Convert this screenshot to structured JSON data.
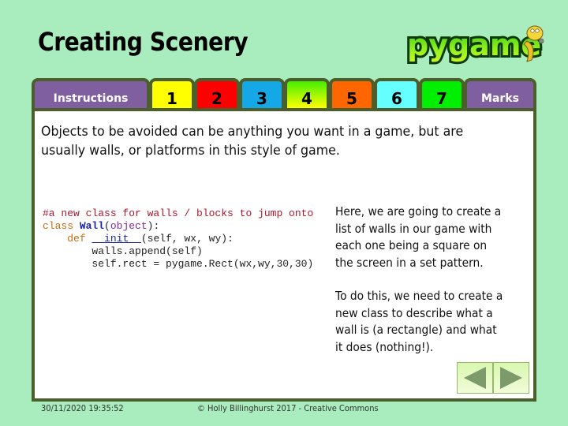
{
  "header": {
    "title": "Creating Scenery",
    "logo_text": "pygame"
  },
  "tabs": [
    {
      "label": "Instructions",
      "color": "#7f5fa0"
    },
    {
      "label": "1",
      "color": "#ffff00"
    },
    {
      "label": "2",
      "color": "#ff0000"
    },
    {
      "label": "3",
      "color": "#14a8e6"
    },
    {
      "label": "4",
      "color": "linear-gradient(#44ee00, #ffff00)"
    },
    {
      "label": "5",
      "color": "#ff6600"
    },
    {
      "label": "6",
      "color": "#66ffff"
    },
    {
      "label": "7",
      "color": "#00ee00"
    },
    {
      "label": "Marks",
      "color": "#7f5fa0"
    }
  ],
  "content": {
    "intro": "Objects to be avoided can be anything you want in a game, but are usually walls, or platforms in this style of game.",
    "code": {
      "line1_comment": "#a new class for walls / blocks to jump onto",
      "line2_kw": "class ",
      "line2_name": "Wall",
      "line2_paren_open": "(",
      "line2_base": "object",
      "line2_rest": "):",
      "line3_indent": "    ",
      "line3_kw": "def ",
      "line3_fn": "__init__",
      "line3_rest": "(self, wx, wy):",
      "line4": "        walls.append(self)",
      "line5": "        self.rect = pygame.Rect(wx,wy,30,30)"
    },
    "side_paragraphs": [
      "Here, we are going to create a list of walls in our game with each one being a square on the screen in a set pattern.",
      "To do this, we need to create a new class to describe what a wall is (a rectangle) and what it does (nothing!)."
    ]
  },
  "nav": {
    "prev_icon": "triangle-left-icon",
    "next_icon": "triangle-right-icon"
  },
  "footer": {
    "date": "30/11/2020 19:35:52",
    "copyright": "© Holly Billinghurst 2017 - Creative Commons"
  }
}
